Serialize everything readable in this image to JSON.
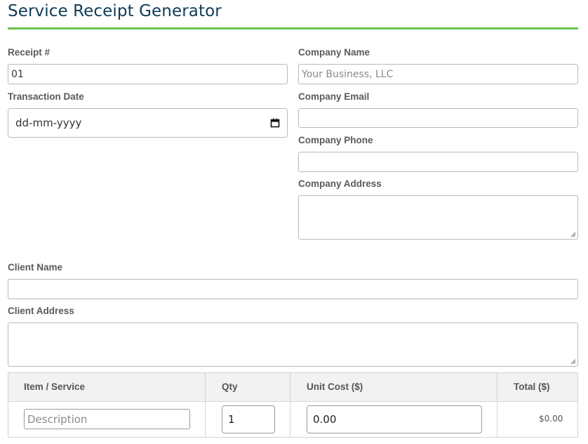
{
  "header": {
    "title": "Service Receipt Generator",
    "accent_color": "#6cc14b",
    "title_color": "#0f3b57"
  },
  "receipt": {
    "number_label": "Receipt #",
    "number_value": "01",
    "date_label": "Transaction Date",
    "date_placeholder": "dd-mm-yyyy",
    "calendar_icon": "calendar-icon"
  },
  "company": {
    "name_label": "Company Name",
    "name_placeholder": "Your Business, LLC",
    "email_label": "Company Email",
    "email_value": "",
    "phone_label": "Company Phone",
    "phone_value": "",
    "address_label": "Company Address",
    "address_value": ""
  },
  "client": {
    "name_label": "Client Name",
    "name_value": "",
    "address_label": "Client Address",
    "address_value": ""
  },
  "items_table": {
    "columns": [
      "Item / Service",
      "Qty",
      "Unit Cost ($)",
      "Total ($)"
    ],
    "rows": [
      {
        "description_placeholder": "Description",
        "qty": "1",
        "unit_cost": "0.00",
        "total": "$0.00"
      }
    ]
  }
}
